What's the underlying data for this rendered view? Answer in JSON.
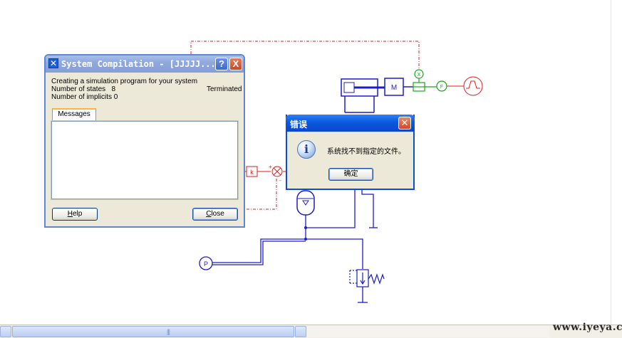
{
  "compilation_window": {
    "title": "System Compilation - [JJJJJ...",
    "help_icon": "?",
    "close_icon": "X",
    "line1": "Creating a simulation program for your system",
    "states_label": "Number of states",
    "states_value": "8",
    "implicits_label": "Number of implicits 0",
    "status": "Terminated",
    "tab_label": "Messages",
    "help_button_mnemonic": "H",
    "help_button_rest": "elp",
    "close_button_mnemonic": "C",
    "close_button_rest": "lose"
  },
  "error_dialog": {
    "title": "错误",
    "icon": "info-icon",
    "message": "系统找不到指定的文件。",
    "ok_label": "确定"
  },
  "diagram": {
    "motor_label": "M",
    "gain_label": "k",
    "pressure_source_label": "P",
    "x_sensor_label": "X",
    "f_sensor_label": "F",
    "plus_sign": "+",
    "minus_sign": "-",
    "colors": {
      "hydraulic": "#1c1ccc",
      "signal": "#dd1c1c",
      "sensor": "#1aa81a"
    }
  },
  "watermark": "www.iyeya.cn",
  "scrollbar": {
    "grip": "|||"
  }
}
